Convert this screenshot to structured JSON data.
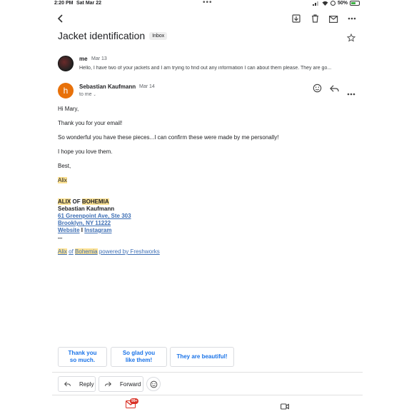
{
  "status_bar": {
    "time": "2:20 PM",
    "date": "Sat Mar 22",
    "battery": "50%"
  },
  "thread": {
    "subject": "Jacket identification",
    "label": "Inbox"
  },
  "message1": {
    "sender": "me",
    "date": "Mar 13",
    "snippet": "Hello, I have two of your jackets and I am trying to find out any information I can about them please. They are go..."
  },
  "message2": {
    "avatar_letter": "h",
    "sender": "Sebastian Kaufmann",
    "date": "Mar 14",
    "to": "to me",
    "body": {
      "greeting": "Hi Mary,",
      "line1": "Thank you for your email!",
      "line2": "So wonderful you have these pieces...I can confirm these were made by me personally!",
      "line3": "I hope you love them.",
      "closing": "Best,",
      "name": "Alix"
    },
    "signature": {
      "brand_part1": "ALIX",
      "brand_part2": "OF",
      "brand_part3": "BOHEMIA",
      "person": "Sebastian Kaufmann",
      "address1": "61 Greenpoint Ave, Ste 303",
      "address2": "Brooklyn, NY 11222",
      "website": "Website",
      "separator": "I",
      "instagram": "Instagram"
    },
    "ellipsis": "•••",
    "footer": {
      "part1": "Alix",
      "part2": "of",
      "part3": "Bohemia",
      "part4": "powered by Freshworks"
    }
  },
  "smart_replies": [
    {
      "line1": "Thank you",
      "line2": "so much."
    },
    {
      "line1": "So glad you",
      "line2": "like them!"
    },
    {
      "line1": "They are beautiful!",
      "line2": ""
    }
  ],
  "actions": {
    "reply": "Reply",
    "forward": "Forward"
  },
  "bottom_nav": {
    "mail_badge": "99+"
  },
  "colors": {
    "highlight": "#fde293",
    "link": "#1a73e8",
    "avatar_h": "#e8710a",
    "badge": "#d93025"
  },
  "icons": [
    "back-arrow-icon",
    "archive-icon",
    "trash-icon",
    "mark-unread-icon",
    "more-vert-icon",
    "star-icon",
    "emoji-icon",
    "reply-icon",
    "forward-icon",
    "mail-icon",
    "video-icon"
  ]
}
